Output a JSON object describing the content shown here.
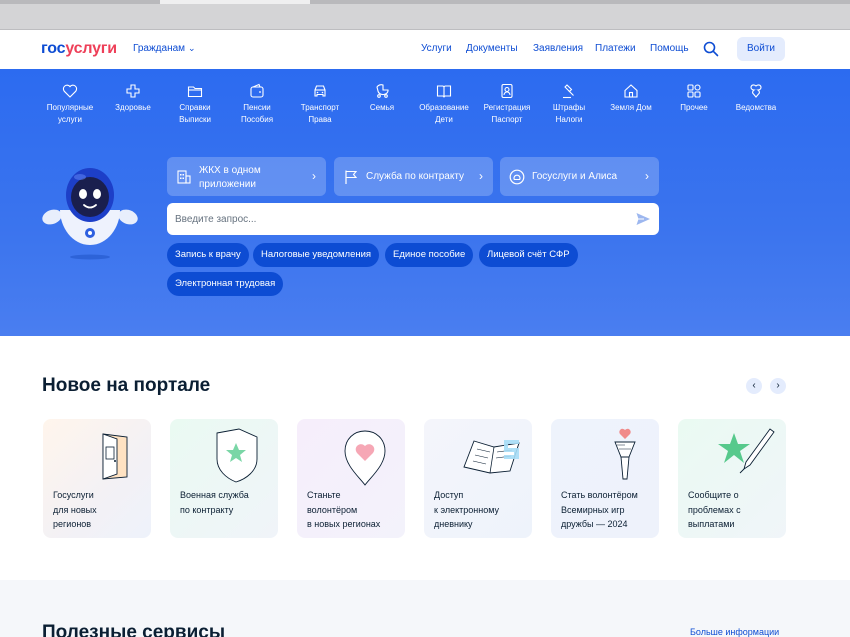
{
  "header": {
    "logo_part1": "гос",
    "logo_part2": "услуги",
    "audience": "Гражданам",
    "nav": [
      "Услуги",
      "Документы",
      "Заявления",
      "Платежи",
      "Помощь"
    ],
    "login": "Войти"
  },
  "categories": [
    {
      "icon": "heart-icon",
      "l1": "Популярные",
      "l2": "услуги"
    },
    {
      "icon": "health-cross-icon",
      "l1": "Здоровье",
      "l2": ""
    },
    {
      "icon": "folder-icon",
      "l1": "Справки",
      "l2": "Выписки"
    },
    {
      "icon": "wallet-icon",
      "l1": "Пенсии",
      "l2": "Пособия"
    },
    {
      "icon": "car-icon",
      "l1": "Транспорт",
      "l2": "Права"
    },
    {
      "icon": "stroller-icon",
      "l1": "Семья",
      "l2": ""
    },
    {
      "icon": "book-icon",
      "l1": "Образование",
      "l2": "Дети"
    },
    {
      "icon": "id-badge-icon",
      "l1": "Регистрация",
      "l2": "Паспорт"
    },
    {
      "icon": "gavel-icon",
      "l1": "Штрафы",
      "l2": "Налоги"
    },
    {
      "icon": "home-icon",
      "l1": "Земля Дом",
      "l2": ""
    },
    {
      "icon": "grid-icon",
      "l1": "Прочее",
      "l2": ""
    },
    {
      "icon": "emblem-icon",
      "l1": "Ведомства",
      "l2": ""
    }
  ],
  "promo": [
    {
      "icon": "building-icon",
      "l1": "ЖКХ в одном",
      "l2": "приложении"
    },
    {
      "icon": "flag-icon",
      "l1": "Служба по контракту",
      "l2": ""
    },
    {
      "icon": "alice-icon",
      "l1": "Госуслуги и Алиса",
      "l2": ""
    }
  ],
  "search": {
    "placeholder": "Введите запрос..."
  },
  "chips": [
    "Запись к врачу",
    "Налоговые уведомления",
    "Единое пособие",
    "Лицевой счёт СФР",
    "Электронная трудовая"
  ],
  "news": {
    "title": "Новое на портале",
    "cards": [
      {
        "l1": "Госуслуги",
        "l2": "для новых",
        "l3": "регионов"
      },
      {
        "l1": "Военная служба",
        "l2": "по контракту",
        "l3": ""
      },
      {
        "l1": "Станьте",
        "l2": "волонтёром",
        "l3": "в новых регионах"
      },
      {
        "l1": "Доступ",
        "l2": "к электронному",
        "l3": "дневнику"
      },
      {
        "l1": "Стать волонтёром",
        "l2": "Всемирных игр",
        "l3": "дружбы — 2024"
      },
      {
        "l1": "Сообщите о",
        "l2": "проблемах с",
        "l3": "выплатами"
      }
    ]
  },
  "useful": {
    "title": "Полезные сервисы",
    "more": "Больше информации"
  },
  "colors": {
    "brand_blue": "#0d4cd3",
    "brand_red": "#ee3f58",
    "hero_blue": "#2c6bf0"
  }
}
